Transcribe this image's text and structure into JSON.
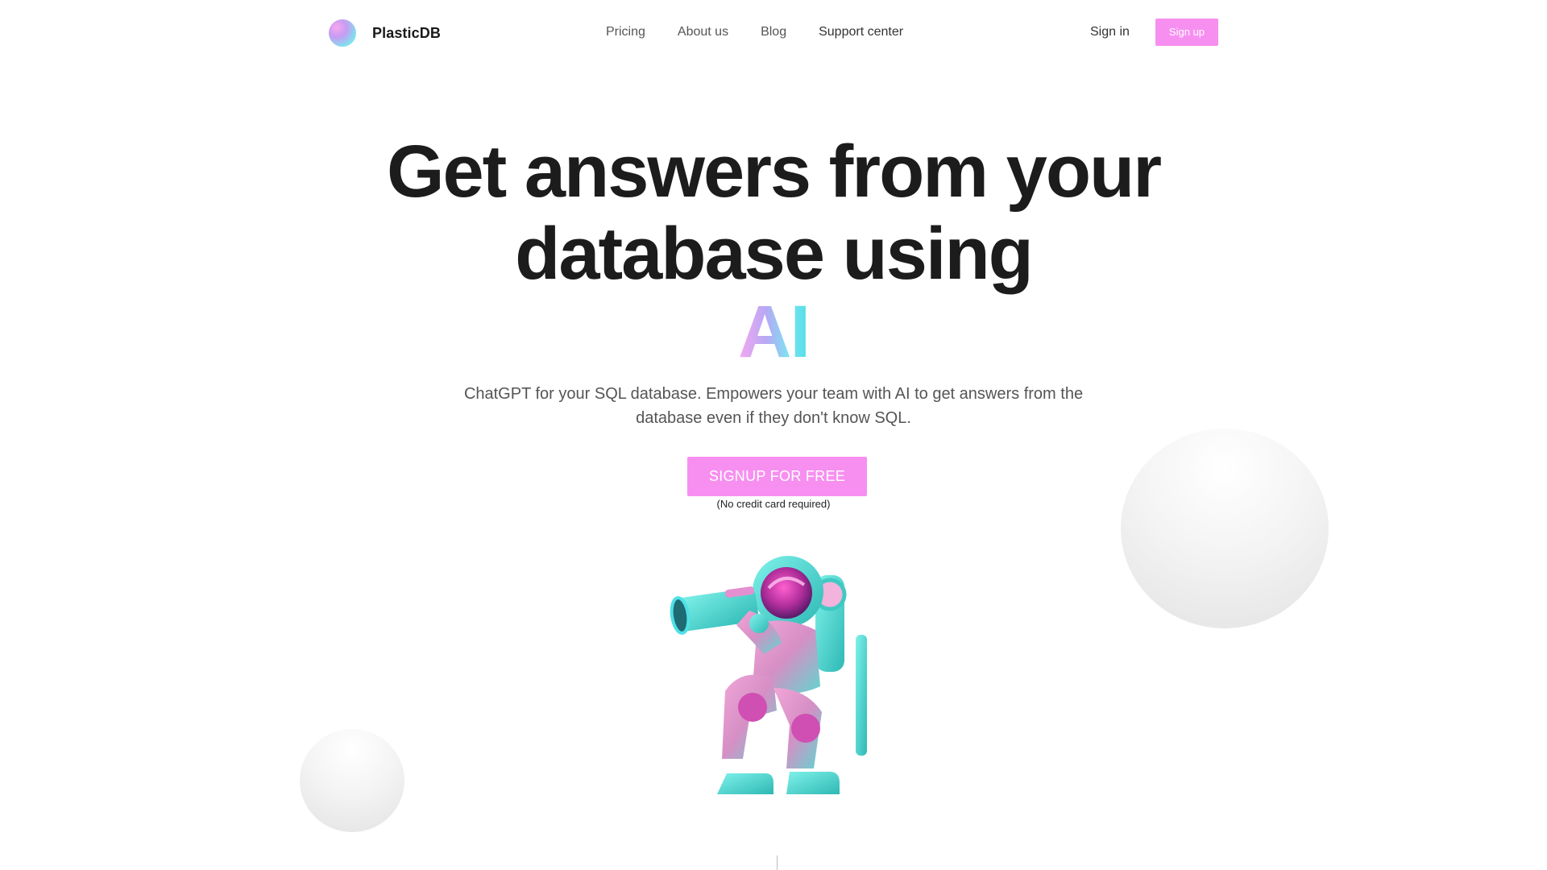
{
  "brand": {
    "name": "PlasticDB",
    "logo_icon": "gradient-orb-logo"
  },
  "nav": {
    "links": [
      {
        "label": "Pricing"
      },
      {
        "label": "About us"
      },
      {
        "label": "Blog"
      },
      {
        "label": "Support center"
      }
    ],
    "signin_label": "Sign in",
    "signup_label": "Sign up"
  },
  "hero": {
    "title_line1": "Get answers from your",
    "title_line2": "database using",
    "title_highlight": "AI",
    "subtitle": "ChatGPT for your SQL database. Empowers your team with AI to get answers from the database even if they don't know SQL.",
    "cta_label": "SIGNUP FOR FREE",
    "cta_note": "(No credit card required)",
    "illustration": "astronaut-with-telescope-illustration"
  },
  "colors": {
    "accent_pink": "#f78ff0",
    "gradient_start": "#f7a7f0",
    "gradient_end": "#4fe0e6",
    "heading": "#1c1c1c",
    "body_text": "#555555"
  }
}
